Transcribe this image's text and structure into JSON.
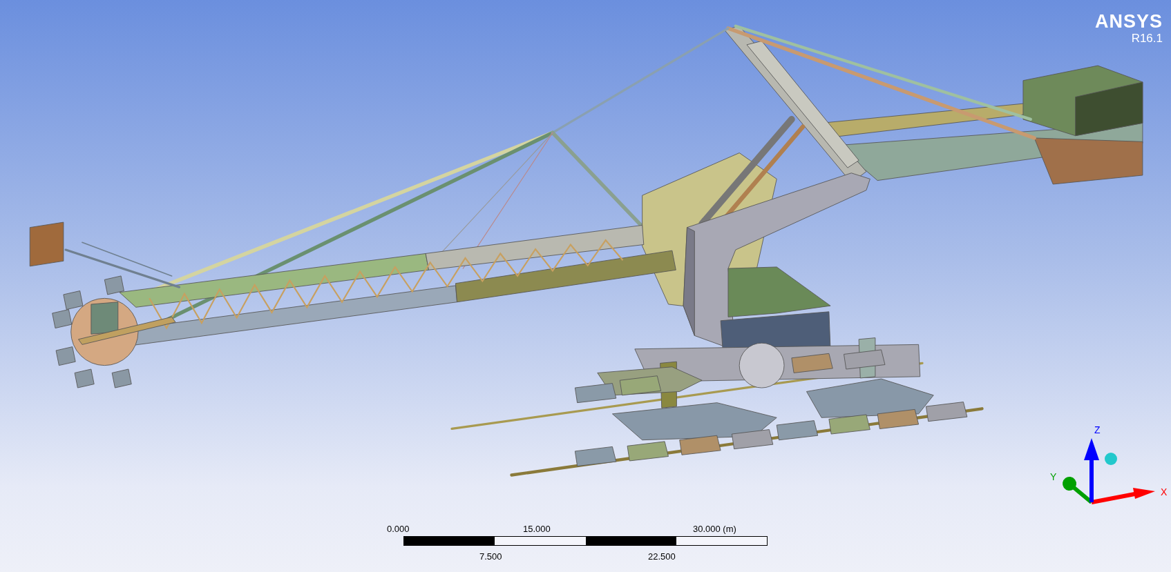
{
  "logo": {
    "name": "ANSYS",
    "version": "R16.1"
  },
  "scale_bar": {
    "top_labels": [
      "0.000",
      "15.000",
      "30.000 (m)"
    ],
    "bottom_labels": [
      "7.500",
      "22.500"
    ]
  },
  "triad": {
    "axes": [
      {
        "label": "X",
        "color": "#ff0000"
      },
      {
        "label": "Y",
        "color": "#00a000"
      },
      {
        "label": "Z",
        "color": "#0000ff"
      }
    ]
  }
}
